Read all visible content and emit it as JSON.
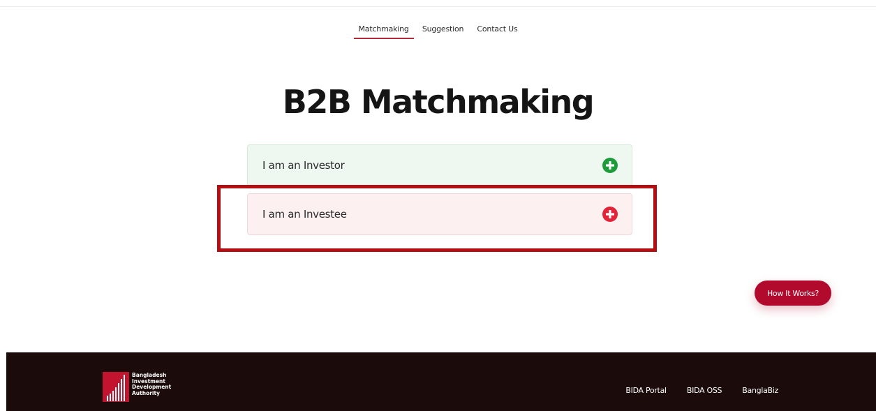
{
  "nav": {
    "items": [
      {
        "label": "Matchmaking",
        "active": true
      },
      {
        "label": "Suggestion",
        "active": false
      },
      {
        "label": "Contact Us",
        "active": false
      }
    ]
  },
  "page": {
    "title": "B2B Matchmaking"
  },
  "roles": {
    "investor": {
      "label": "I am an Investor",
      "icon": "plus-circle-icon",
      "color": "#1e9c3c"
    },
    "investee": {
      "label": "I am an Investee",
      "icon": "plus-circle-icon",
      "color": "#e2243a"
    }
  },
  "help": {
    "how_it_works_label": "How It Works?"
  },
  "footer": {
    "logo_lines": [
      "Bangladesh",
      "Investment",
      "Development",
      "Authority"
    ],
    "links": [
      "BIDA Portal",
      "BIDA OSS",
      "BanglaBiz"
    ]
  },
  "colors": {
    "accent": "#b10a2c",
    "highlight": "#b30f12",
    "footer_bg": "#1c0b0b"
  }
}
